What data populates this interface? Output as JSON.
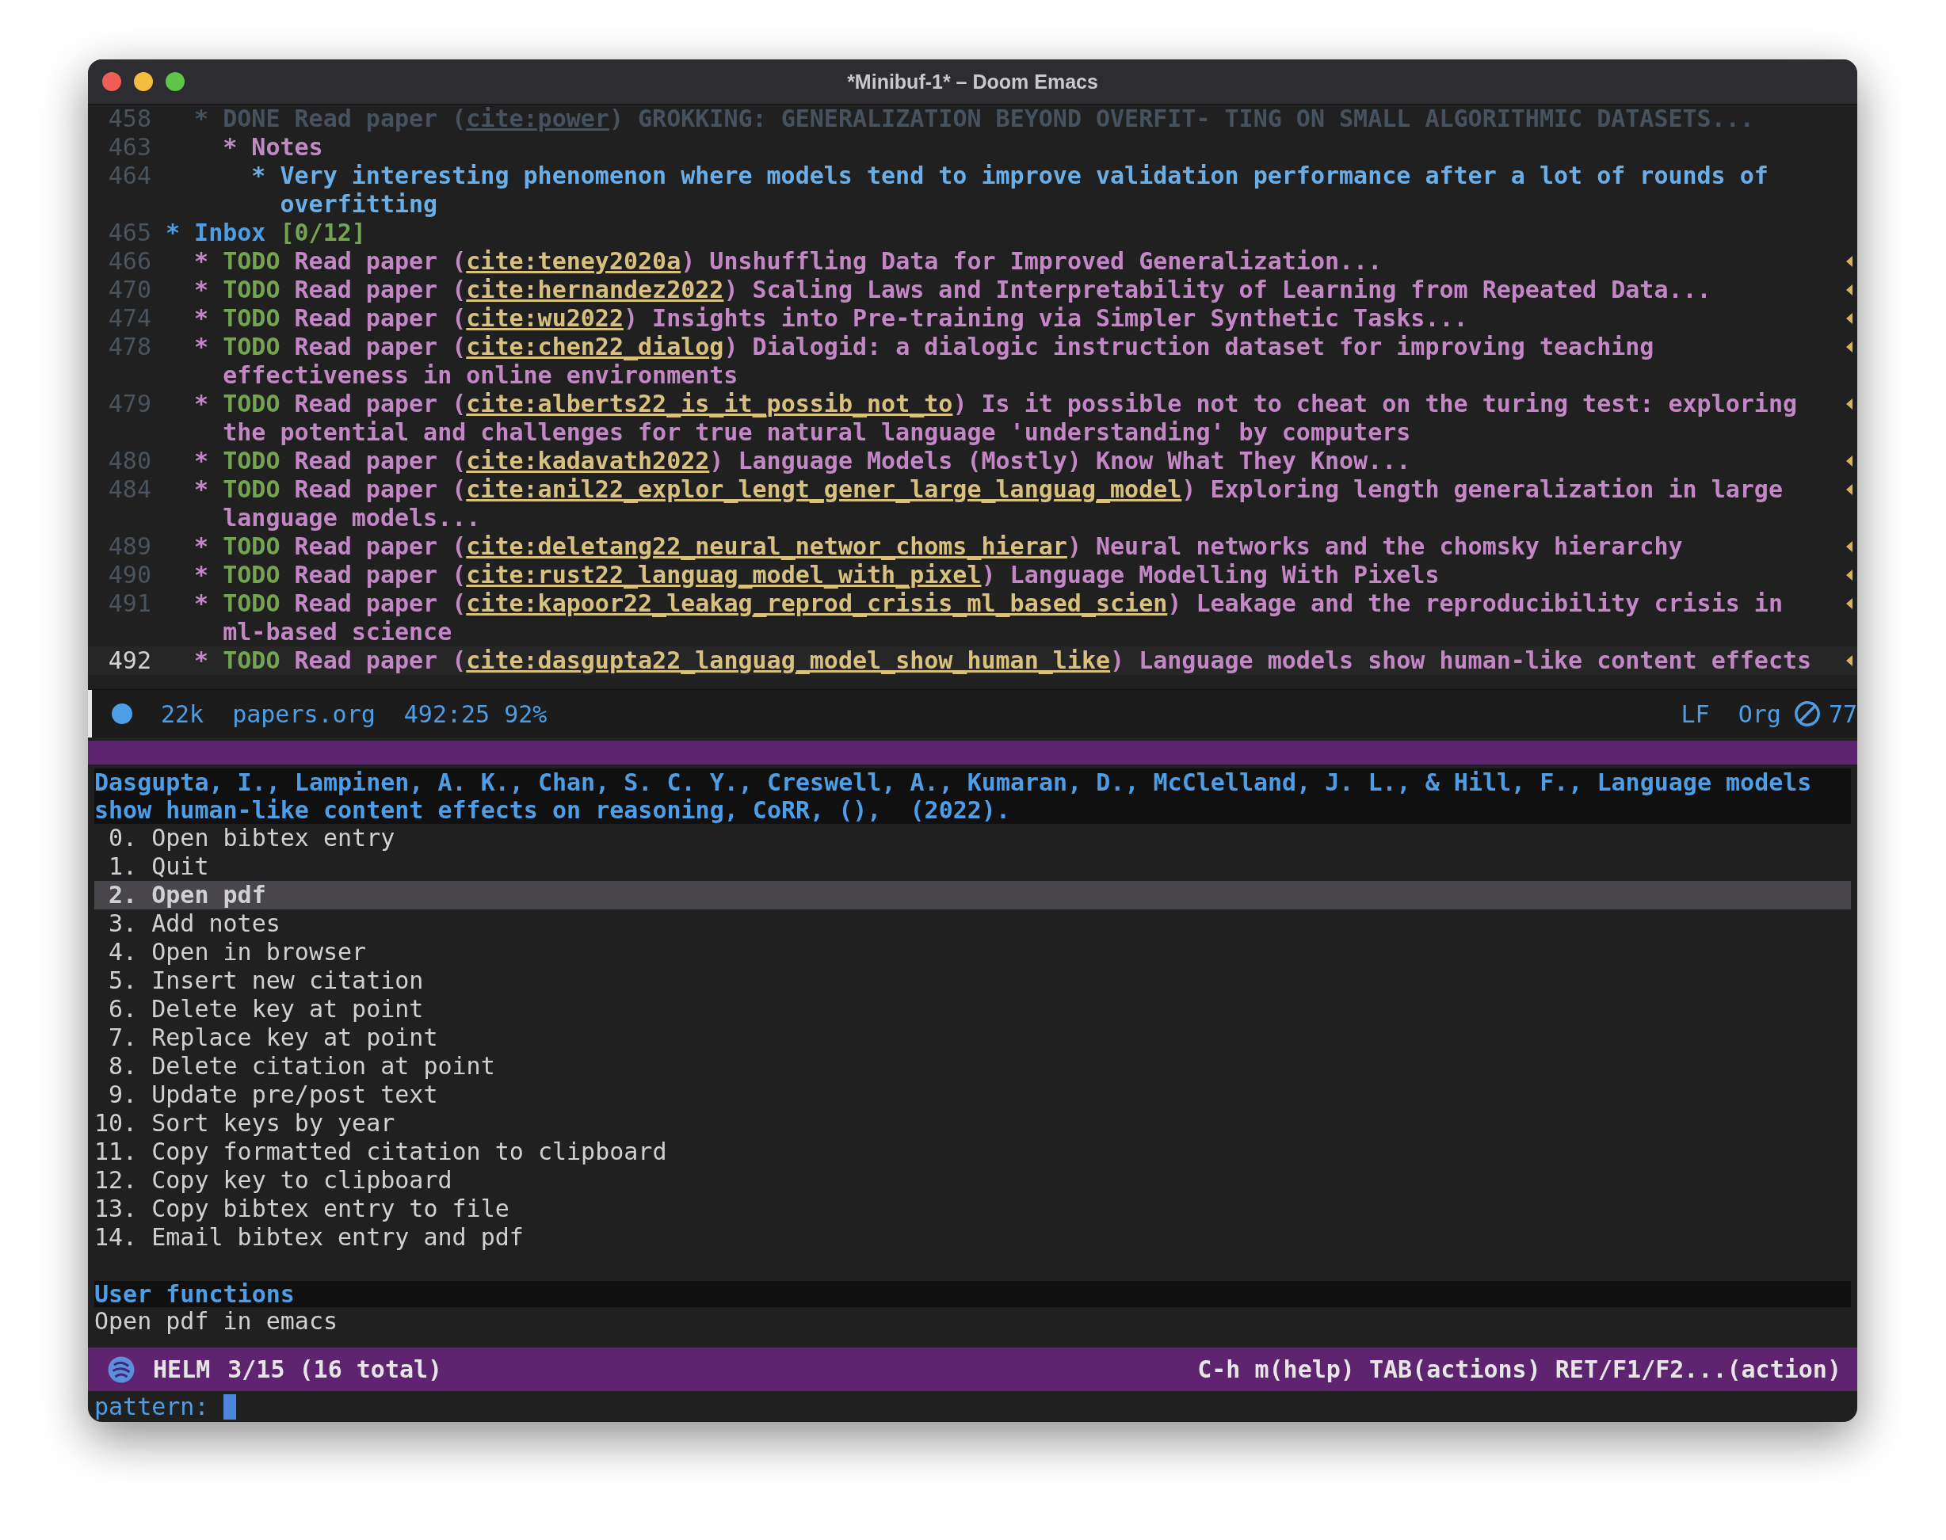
{
  "window": {
    "title": "*Minibuf-1* – Doom Emacs"
  },
  "outline": [
    {
      "number": "458",
      "kind": "done",
      "bullet": "*",
      "keyword": "DONE",
      "prefix": "Read paper (",
      "cite": "cite:power",
      "title": ") GROKKING: GENERALIZATION BEYOND OVERFIT- TING ON SMALL ALGORITHMIC DATASETS...",
      "current": false,
      "folded": false,
      "children": [
        {
          "number": "463",
          "kind": "subheading",
          "bullet": "*",
          "title": "Notes",
          "current": false,
          "folded": false,
          "children": [
            {
              "number": "464",
              "kind": "note",
              "bullet": "*",
              "title": "Very interesting phenomenon where models tend to improve validation performance after a lot of rounds of",
              "continuation": "overfitting",
              "current": false,
              "folded": false
            }
          ]
        }
      ]
    },
    {
      "number": "465",
      "kind": "heading",
      "bullet": "*",
      "title": "Inbox",
      "progress": "[0/12]",
      "current": false,
      "folded": false,
      "children": [
        {
          "number": "466",
          "kind": "todo",
          "bullet": "*",
          "keyword": "TODO",
          "prefix": "Read paper (",
          "cite": "cite:teney2020a",
          "title": ") Unshuffling Data for Improved Generalization...",
          "current": false,
          "folded": true
        },
        {
          "number": "470",
          "kind": "todo",
          "bullet": "*",
          "keyword": "TODO",
          "prefix": "Read paper (",
          "cite": "cite:hernandez2022",
          "title": ") Scaling Laws and Interpretability of Learning from Repeated Data...",
          "current": false,
          "folded": true
        },
        {
          "number": "474",
          "kind": "todo",
          "bullet": "*",
          "keyword": "TODO",
          "prefix": "Read paper (",
          "cite": "cite:wu2022",
          "title": ") Insights into Pre-training via Simpler Synthetic Tasks...",
          "current": false,
          "folded": true
        },
        {
          "number": "478",
          "kind": "todo",
          "bullet": "*",
          "keyword": "TODO",
          "prefix": "Read paper (",
          "cite": "cite:chen22_dialog",
          "title": ") Dialogid: a dialogic instruction dataset for improving teaching",
          "continuation": "effectiveness in online environments",
          "current": false,
          "folded": true
        },
        {
          "number": "479",
          "kind": "todo",
          "bullet": "*",
          "keyword": "TODO",
          "prefix": "Read paper (",
          "cite": "cite:alberts22_is_it_possib_not_to",
          "title": ") Is it possible not to cheat on the turing test: exploring",
          "continuation": "the potential and challenges for true natural language 'understanding' by computers",
          "current": false,
          "folded": true
        },
        {
          "number": "480",
          "kind": "todo",
          "bullet": "*",
          "keyword": "TODO",
          "prefix": "Read paper (",
          "cite": "cite:kadavath2022",
          "title": ") Language Models (Mostly) Know What They Know...",
          "current": false,
          "folded": true
        },
        {
          "number": "484",
          "kind": "todo",
          "bullet": "*",
          "keyword": "TODO",
          "prefix": "Read paper (",
          "cite": "cite:anil22_explor_lengt_gener_large_languag_model",
          "title": ") Exploring length generalization in large",
          "continuation": "language models...",
          "current": false,
          "folded": true
        },
        {
          "number": "489",
          "kind": "todo",
          "bullet": "*",
          "keyword": "TODO",
          "prefix": "Read paper (",
          "cite": "cite:deletang22_neural_networ_choms_hierar",
          "title": ") Neural networks and the chomsky hierarchy",
          "current": false,
          "folded": true
        },
        {
          "number": "490",
          "kind": "todo",
          "bullet": "*",
          "keyword": "TODO",
          "prefix": "Read paper (",
          "cite": "cite:rust22_languag_model_with_pixel",
          "title": ") Language Modelling With Pixels",
          "current": false,
          "folded": true
        },
        {
          "number": "491",
          "kind": "todo",
          "bullet": "*",
          "keyword": "TODO",
          "prefix": "Read paper (",
          "cite": "cite:kapoor22_leakag_reprod_crisis_ml_based_scien",
          "title": ") Leakage and the reproducibility crisis in",
          "continuation": "ml-based science",
          "current": false,
          "folded": true
        },
        {
          "number": "492",
          "kind": "todo",
          "bullet": "*",
          "keyword": "TODO",
          "prefix": "Read paper (",
          "cite": "cite:dasgupta22_languag_model_show_human_like",
          "title": ") Language models show human-like content effects",
          "current": true,
          "folded": true
        }
      ]
    }
  ],
  "mode_line": {
    "size": "22k",
    "file": "papers.org",
    "position": "492:25 92%",
    "eol": "LF",
    "mode": "Org",
    "count": "77"
  },
  "helm": {
    "candidate_lines": [
      "Dasgupta, I., Lampinen, A. K., Chan, S. C. Y., Creswell, A., Kumaran, D., McClelland, J. L., & Hill, F., Language models",
      "show human-like content effects on reasoning, CoRR, (),  (2022)."
    ],
    "actions": [
      {
        "number": "0.",
        "label": "Open bibtex entry",
        "selected": false
      },
      {
        "number": "1.",
        "label": "Quit",
        "selected": false
      },
      {
        "number": "2.",
        "label": "Open pdf",
        "selected": true
      },
      {
        "number": "3.",
        "label": "Add notes",
        "selected": false
      },
      {
        "number": "4.",
        "label": "Open in browser",
        "selected": false
      },
      {
        "number": "5.",
        "label": "Insert new citation",
        "selected": false
      },
      {
        "number": "6.",
        "label": "Delete key at point",
        "selected": false
      },
      {
        "number": "7.",
        "label": "Replace key at point",
        "selected": false
      },
      {
        "number": "8.",
        "label": "Delete citation at point",
        "selected": false
      },
      {
        "number": "9.",
        "label": "Update pre/post text",
        "selected": false
      },
      {
        "number": "10.",
        "label": "Sort keys by year",
        "selected": false
      },
      {
        "number": "11.",
        "label": "Copy formatted citation to clipboard",
        "selected": false
      },
      {
        "number": "12.",
        "label": "Copy key to clipboard",
        "selected": false
      },
      {
        "number": "13.",
        "label": "Copy bibtex entry to file",
        "selected": false
      },
      {
        "number": "14.",
        "label": "Email bibtex entry and pdf",
        "selected": false
      }
    ],
    "section_title": "User functions",
    "section_items": [
      {
        "label": "Open pdf in emacs"
      }
    ],
    "mode_line": {
      "name": "HELM",
      "count": "3/15 (16 total)",
      "keys": "C-h m(help) TAB(actions) RET/F1/F2...(action)"
    },
    "prompt": "pattern:"
  }
}
